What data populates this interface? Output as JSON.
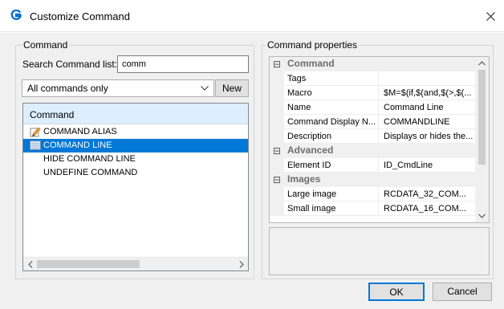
{
  "window": {
    "title": "Customize Command",
    "close_icon": "close-icon",
    "app_icon": "gstarcad-icon",
    "accent_color": "#0078d7"
  },
  "command_group": {
    "label": "Command",
    "search_label": "Search Command list:",
    "search_value": "comm",
    "filter_selected": "All commands only",
    "new_button": "New",
    "list_header": "Command",
    "items": [
      {
        "label": "COMMAND ALIAS",
        "icon": "edit-pencil-icon",
        "selected": false
      },
      {
        "label": "COMMAND LINE",
        "icon": "command-line-icon",
        "selected": true
      },
      {
        "label": "HIDE COMMAND LINE",
        "icon": "",
        "selected": false
      },
      {
        "label": "UNDEFINE COMMAND",
        "icon": "",
        "selected": false
      }
    ]
  },
  "properties_group": {
    "label": "Command properties",
    "categories": {
      "command": "Command",
      "advanced": "Advanced",
      "images": "Images"
    },
    "collapse_symbol": "⊟",
    "rows": {
      "tags": {
        "name": "Tags",
        "value": ""
      },
      "macro": {
        "name": "Macro",
        "value": "$M=$(if,$(and,$(>,$(..."
      },
      "name": {
        "name": "Name",
        "value": "Command Line"
      },
      "display_name": {
        "name": "Command Display N...",
        "value": "COMMANDLINE"
      },
      "description": {
        "name": "Description",
        "value": "Displays or hides the..."
      },
      "element_id": {
        "name": "Element ID",
        "value": "ID_CmdLine"
      },
      "large_image": {
        "name": "Large image",
        "value": "RCDATA_32_COM..."
      },
      "small_image": {
        "name": "Small image",
        "value": "RCDATA_16_COM..."
      }
    }
  },
  "footer": {
    "ok": "OK",
    "cancel": "Cancel"
  }
}
